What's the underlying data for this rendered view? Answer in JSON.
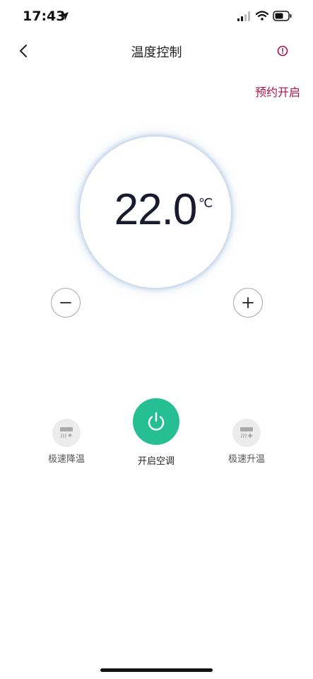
{
  "status_bar": {
    "time": "17:43"
  },
  "header": {
    "title": "温度控制"
  },
  "schedule_label": "预约开启",
  "thermostat": {
    "temperature": "22.0",
    "unit": "℃"
  },
  "controls": {
    "cool_label": "极速降温",
    "power_label": "开启空调",
    "heat_label": "极速升温"
  },
  "colors": {
    "accent_red": "#b0124a",
    "power_green": "#26bf94",
    "icon_gray": "#a9a9a9"
  }
}
